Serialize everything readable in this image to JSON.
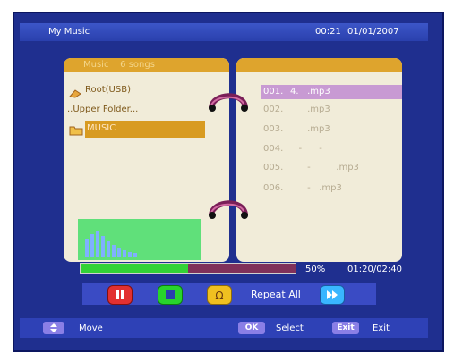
{
  "header": {
    "title": "My Music",
    "time": "00:21",
    "date": "01/01/2007"
  },
  "left_panel": {
    "header": "Music    6 songs",
    "items": [
      {
        "label": "Root(USB)",
        "icon": "usb-drive-icon"
      },
      {
        "label": "..Upper Folder...",
        "icon": ""
      },
      {
        "label": "MUSIC",
        "icon": "folder-icon",
        "selected": true
      }
    ]
  },
  "right_panel": {
    "header": "",
    "files": [
      {
        "num": "001.",
        "name": "4.   .mp3",
        "highlighted": true
      },
      {
        "num": "002.",
        "name": "      .mp3"
      },
      {
        "num": "003.",
        "name": "      .mp3"
      },
      {
        "num": "004.",
        "name": "   -      -"
      },
      {
        "num": "005.",
        "name": "      -         .mp3"
      },
      {
        "num": "006.",
        "name": "      -   .mp3"
      }
    ]
  },
  "playback": {
    "progress_percent": 50,
    "progress_label": "50%",
    "time": "01:20/02:40"
  },
  "controls": {
    "repeat_label": "Repeat All",
    "buttons": [
      "red-button-icon",
      "green-button-icon",
      "yellow-button-icon",
      "blue-button-icon"
    ]
  },
  "footer": {
    "move_label": "Move",
    "ok_key": "OK",
    "select_label": "Select",
    "exit_key": "Exit",
    "exit_label": "Exit"
  },
  "colors": {
    "background": "#1f2f8f",
    "panel": "#f1ecd9",
    "panel_header": "#dea42d",
    "selection": "#d89b21",
    "highlight": "#c89ad3",
    "progress_fill": "#32d236",
    "progress_bg": "#80305a"
  }
}
